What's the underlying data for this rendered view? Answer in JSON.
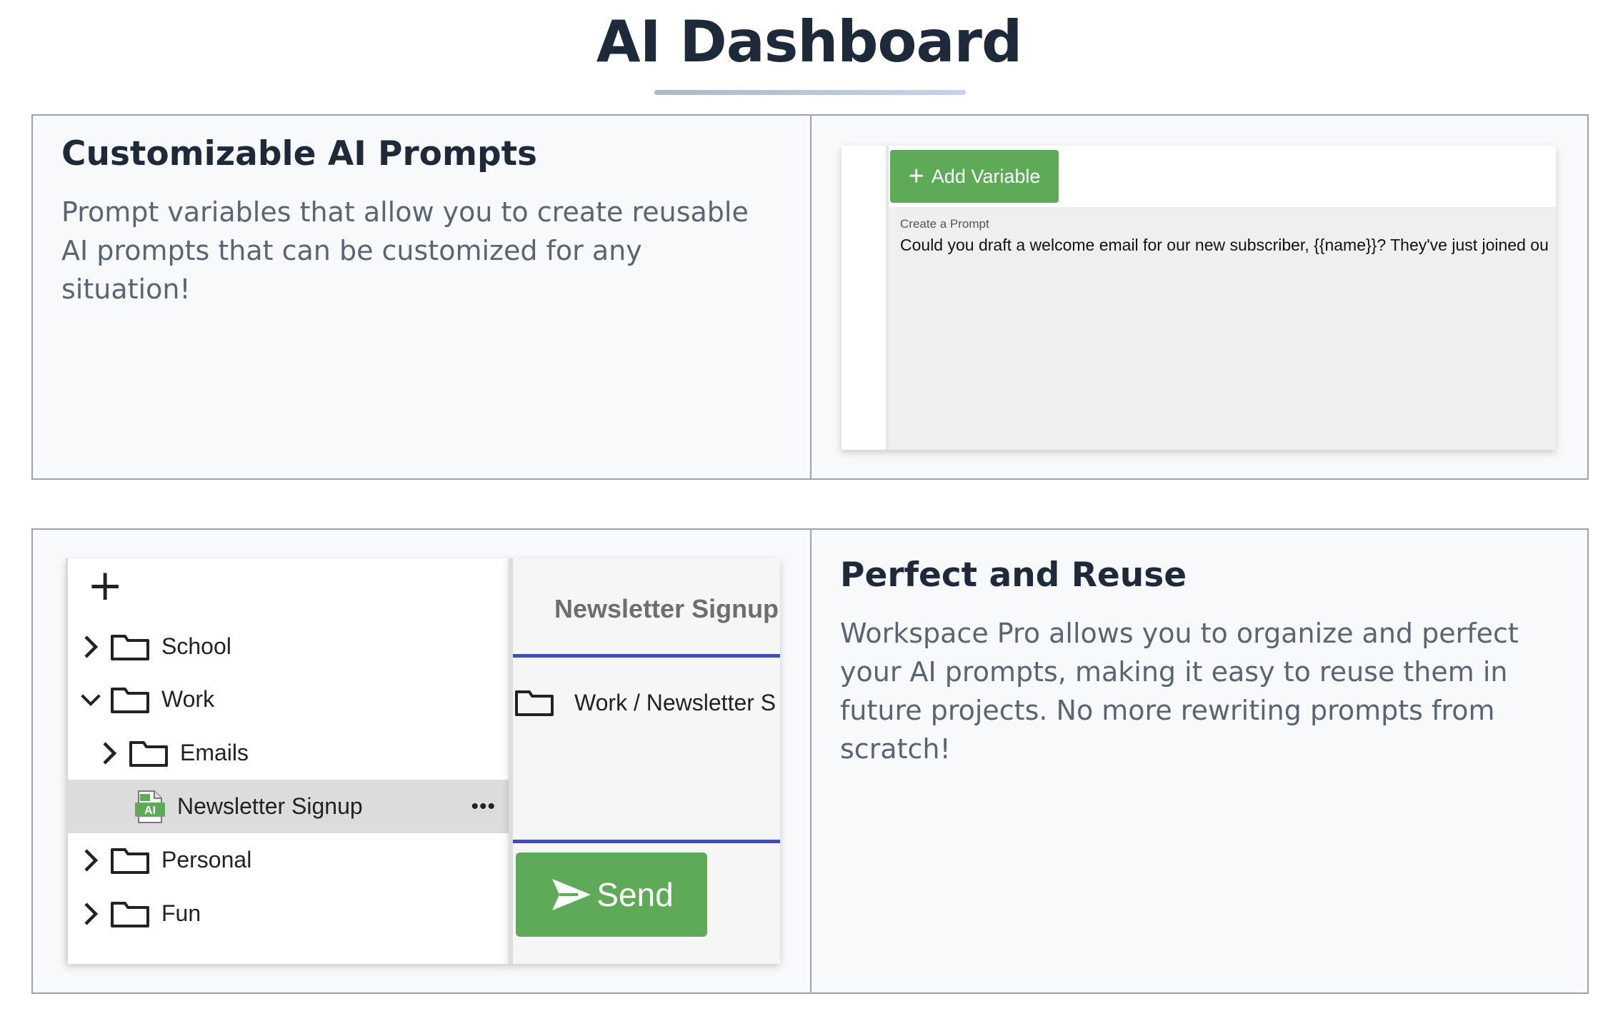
{
  "page": {
    "title": "AI Dashboard"
  },
  "features": [
    {
      "title": "Customizable AI Prompts",
      "description": "Prompt variables that allow you to create reusable AI prompts that can be customized for any situation!"
    },
    {
      "title": "Perfect and Reuse",
      "description": "Workspace Pro allows you to organize and perfect your AI prompts, making it easy to reuse them in future projects. No more rewriting prompts from scratch!"
    }
  ],
  "prompt_editor": {
    "add_variable_label": "Add Variable",
    "prompt_label": "Create a Prompt",
    "prompt_text": "Could you draft a welcome email for our new subscriber, {{name}}? They've just joined ou"
  },
  "file_tree": {
    "items": [
      {
        "label": "School"
      },
      {
        "label": "Work"
      },
      {
        "label": "Emails"
      },
      {
        "label": "Newsletter Signup"
      },
      {
        "label": "Personal"
      },
      {
        "label": "Fun"
      }
    ]
  },
  "document": {
    "title": "Newsletter Signup:",
    "path": "Work / Newsletter S",
    "send_label": "Send"
  },
  "colors": {
    "accent_green": "#5eaa58",
    "divider_blue": "#3f4fb4",
    "heading": "#1e2a3a"
  }
}
